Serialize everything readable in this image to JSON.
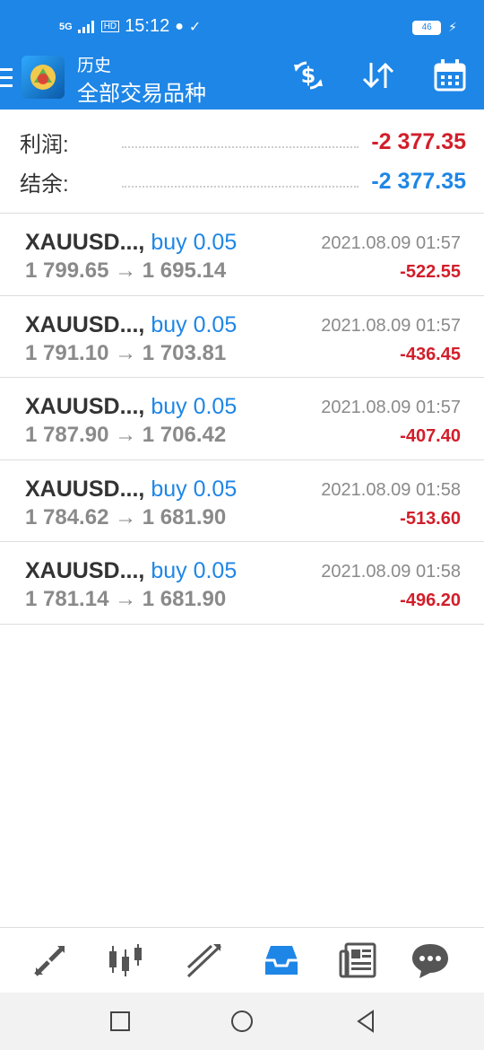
{
  "status_bar": {
    "network": "5G",
    "hd": "HD",
    "time": "15:12",
    "battery": "46"
  },
  "app_bar": {
    "subtitle": "历史",
    "title": "全部交易品种",
    "icons": [
      "menu-icon",
      "app-logo",
      "currency-exchange-icon",
      "sort-icon",
      "calendar-icon"
    ]
  },
  "summary": {
    "profit_label": "利润:",
    "profit_value": "-2 377.35",
    "balance_label": "结余:",
    "balance_value": "-2 377.35",
    "profit_color": "#d21e2a",
    "balance_color": "#1e86e6"
  },
  "trades": [
    {
      "symbol": "XAUUSD...,",
      "direction": "buy 0.05",
      "prices": "1 799.65 → 1 695.14",
      "time": "2021.08.09 01:57",
      "profit": "-522.55"
    },
    {
      "symbol": "XAUUSD...,",
      "direction": "buy 0.05",
      "prices": "1 791.10 → 1 703.81",
      "time": "2021.08.09 01:57",
      "profit": "-436.45"
    },
    {
      "symbol": "XAUUSD...,",
      "direction": "buy 0.05",
      "prices": "1 787.90 → 1 706.42",
      "time": "2021.08.09 01:57",
      "profit": "-407.40"
    },
    {
      "symbol": "XAUUSD...,",
      "direction": "buy 0.05",
      "prices": "1 784.62 → 1 681.90",
      "time": "2021.08.09 01:58",
      "profit": "-513.60"
    },
    {
      "symbol": "XAUUSD...,",
      "direction": "buy 0.05",
      "prices": "1 781.14 → 1 681.90",
      "time": "2021.08.09 01:58",
      "profit": "-496.20"
    }
  ],
  "tab_bar": {
    "icons": [
      "quotes-icon",
      "chart-icon",
      "trade-icon",
      "history-icon",
      "news-icon",
      "chat-icon"
    ],
    "active": "history-icon",
    "active_color": "#1e86e6"
  },
  "nav_bar": {
    "icons": [
      "recent-apps-icon",
      "home-icon",
      "back-icon"
    ]
  }
}
